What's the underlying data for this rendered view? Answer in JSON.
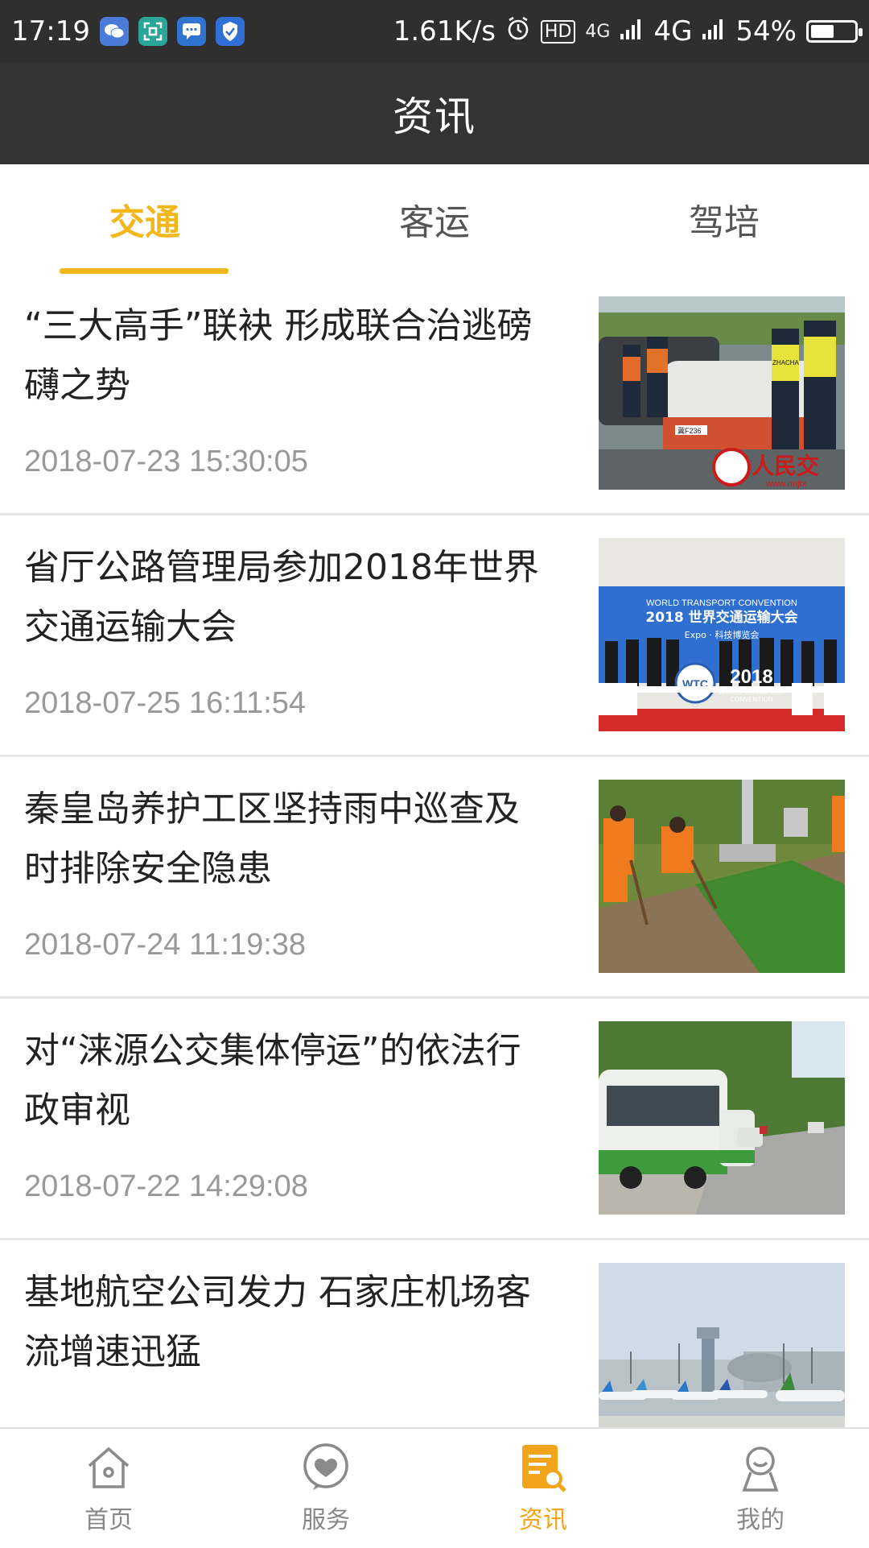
{
  "status_bar": {
    "time": "17:19",
    "net_speed": "1.61K/s",
    "hd": "HD",
    "signal_small": "4G",
    "network": "4G",
    "battery": "54%",
    "battery_level": 0.54
  },
  "header": {
    "title": "资讯"
  },
  "tabs": [
    {
      "label": "交通",
      "active": true
    },
    {
      "label": "客运",
      "active": false
    },
    {
      "label": "驾培",
      "active": false
    }
  ],
  "news": [
    {
      "title": "“三大高手”联袂 形成联合治逃磅礴之势",
      "time": "2018-07-23 15:30:05"
    },
    {
      "title": "省厅公路管理局参加2018年世界交通运输大会",
      "time": "2018-07-25 16:11:54"
    },
    {
      "title": "秦皇岛养护工区坚持雨中巡查及时排除安全隐患",
      "time": "2018-07-24 11:19:38"
    },
    {
      "title": "对“涞源公交集体停运”的依法行政审视",
      "time": "2018-07-22 14:29:08"
    },
    {
      "title": "基地航空公司发力 石家庄机场客流增速迅猛",
      "time": ""
    }
  ],
  "thumb_text": {
    "img1_logo": "人民交",
    "img1_url": "www.rmjtx",
    "img1_plate": "冀F236",
    "img1_vest": "ZHACHA",
    "img2_line1": "WORLD TRANSPORT CONVENTION",
    "img2_line2": "2018 世界交通运输大会",
    "img2_line3": "Expo · 科技博览会",
    "img2_logo": "WTC",
    "img2_year": "2018",
    "img2_sub": "WORLD TRANSPORT",
    "img2_sub2": "CONVENTION"
  },
  "bottom_nav": [
    {
      "label": "首页",
      "icon": "home-icon",
      "active": false
    },
    {
      "label": "服务",
      "icon": "service-icon",
      "active": false
    },
    {
      "label": "资讯",
      "icon": "news-icon",
      "active": true
    },
    {
      "label": "我的",
      "icon": "profile-icon",
      "active": false
    }
  ],
  "colors": {
    "accent": "#f2b71a",
    "statusbar": "#2f2f2f",
    "titlebar": "#333333",
    "divider": "#e6e6e6",
    "time_text": "#999999"
  }
}
